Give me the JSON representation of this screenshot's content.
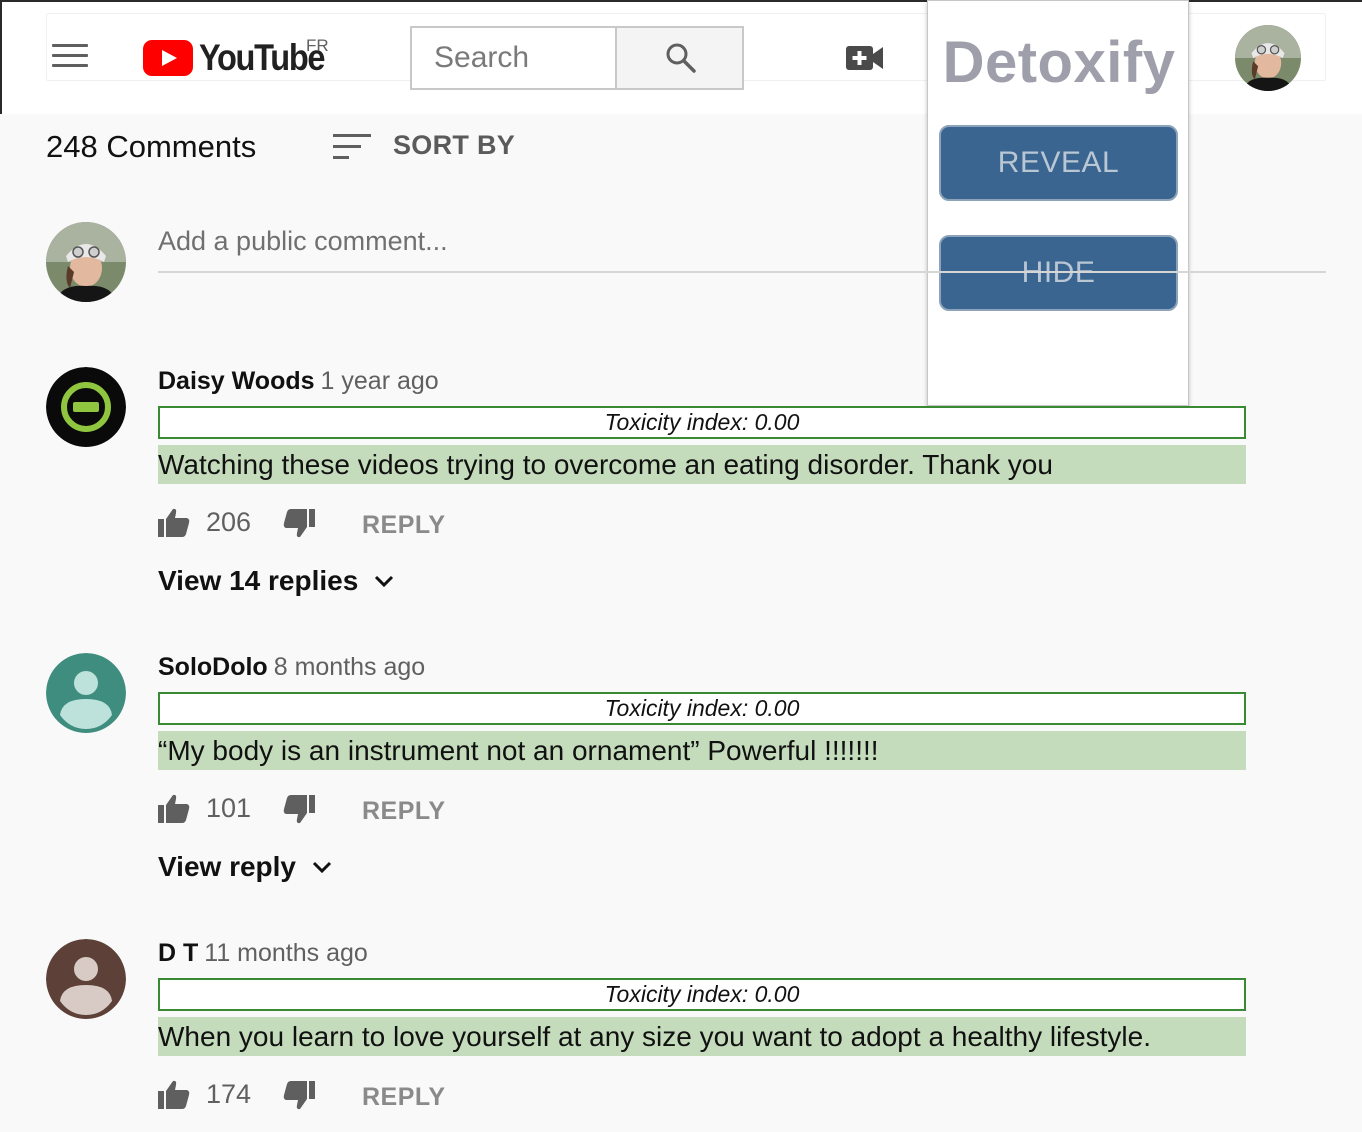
{
  "header": {
    "logo_text": "YouTube",
    "region": "FR",
    "search_placeholder": "Search"
  },
  "detoxify": {
    "title": "Detoxify",
    "reveal_label": "REVEAL",
    "hide_label": "HIDE"
  },
  "comments": {
    "count_label": "248 Comments",
    "sort_label": "SORT BY",
    "add_placeholder": "Add a public comment...",
    "items": [
      {
        "author": "Daisy Woods",
        "time": "1 year ago",
        "toxicity": "Toxicity index: 0.00",
        "text": "Watching these videos trying to overcome an eating disorder. Thank you",
        "likes": "206",
        "reply_label": "REPLY",
        "view_replies": "View 14 replies",
        "avatar_icon": "no-entry-badge-icon"
      },
      {
        "author": "SoloDolo",
        "time": "8 months ago",
        "toxicity": "Toxicity index: 0.00",
        "text": "“My body is an instrument not an ornament” Powerful !!!!!!!",
        "likes": "101",
        "reply_label": "REPLY",
        "view_replies": "View reply",
        "avatar_icon": "default-user-icon"
      },
      {
        "author": "D T",
        "time": "11 months ago",
        "toxicity": "Toxicity index: 0.00",
        "text": "When you learn to love yourself at any size you want to adopt a healthy lifestyle.",
        "likes": "174",
        "reply_label": "REPLY",
        "avatar_icon": "default-user-icon"
      }
    ]
  },
  "colors": {
    "detox_button": "#3a6590",
    "toxicity_border": "#3a8a34",
    "comment_highlight": "#c4dcbc",
    "youtube_red": "#ff0000"
  }
}
